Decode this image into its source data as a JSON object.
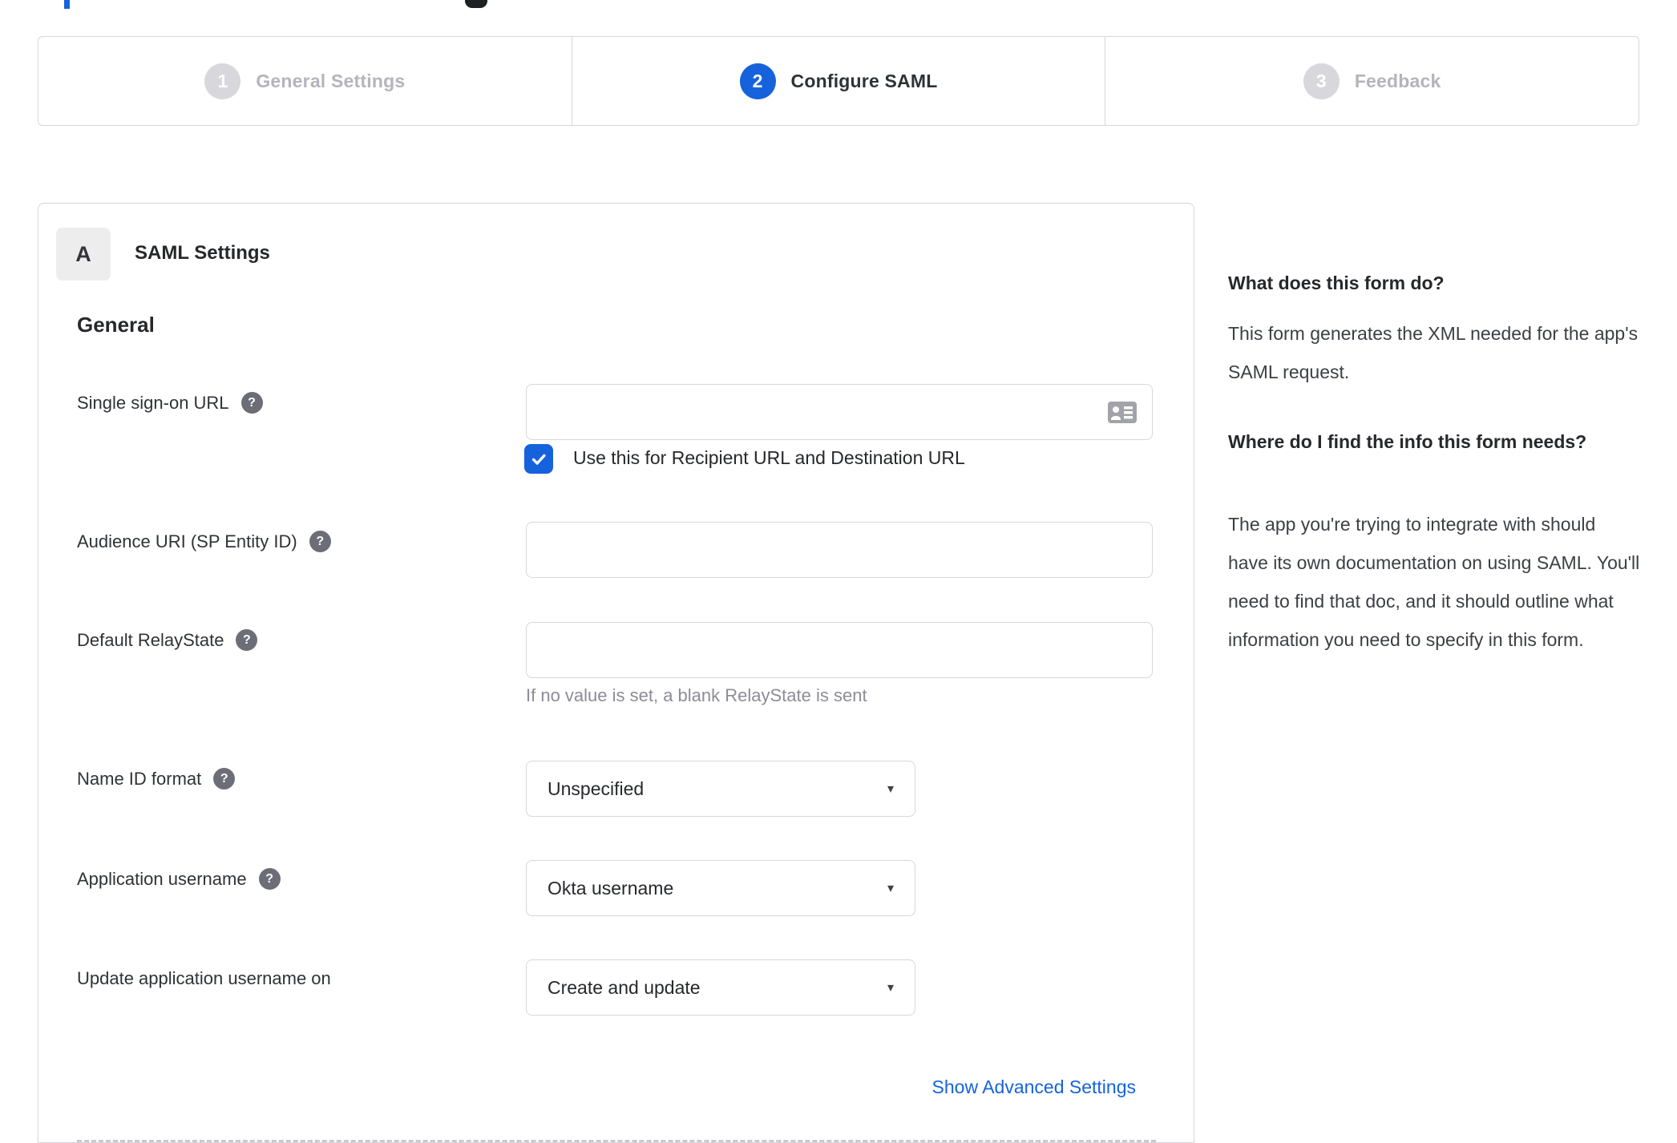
{
  "colors": {
    "accent_blue": "#1662dd",
    "border_gray": "#d7d7dc",
    "inactive_gray": "#b4b4bc",
    "help_icon_gray": "#6d6d78",
    "hint_gray": "#8c8c96"
  },
  "icons": {
    "help_glyph": "?",
    "caret_glyph": "▾"
  },
  "stepper": {
    "steps": [
      {
        "number": "1",
        "label": "General Settings",
        "state": "inactive"
      },
      {
        "number": "2",
        "label": "Configure SAML",
        "state": "active"
      },
      {
        "number": "3",
        "label": "Feedback",
        "state": "inactive"
      }
    ]
  },
  "panel": {
    "section_badge": "A",
    "section_title": "SAML Settings",
    "group_title": "General",
    "fields": {
      "sso_url": {
        "label": "Single sign-on URL",
        "value": "",
        "checkbox_label": "Use this for Recipient URL and Destination URL",
        "checkbox_checked": true
      },
      "audience_uri": {
        "label": "Audience URI (SP Entity ID)",
        "value": ""
      },
      "relay_state": {
        "label": "Default RelayState",
        "value": "",
        "hint": "If no value is set, a blank RelayState is sent"
      },
      "name_id_format": {
        "label": "Name ID format",
        "value": "Unspecified"
      },
      "application_username": {
        "label": "Application username",
        "value": "Okta username"
      },
      "update_application_username_on": {
        "label": "Update application username on",
        "value": "Create and update"
      }
    },
    "advanced_link": "Show Advanced Settings"
  },
  "help": {
    "heading1": "What does this form do?",
    "paragraph1": "This form generates the XML needed for the app's SAML request.",
    "heading2": "Where do I find the info this form needs?",
    "paragraph2": "The app you're trying to integrate with should have its own documentation on using SAML. You'll need to find that doc, and it should outline what information you need to specify in this form."
  }
}
